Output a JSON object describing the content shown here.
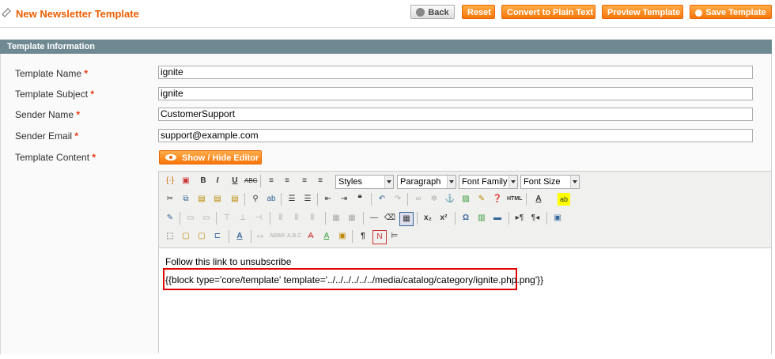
{
  "header": {
    "title": "New Newsletter Template",
    "buttons": {
      "back": "Back",
      "reset": "Reset",
      "convert": "Convert to Plain Text",
      "preview": "Preview Template",
      "save": "Save Template"
    }
  },
  "section": {
    "title": "Template Information"
  },
  "form": {
    "template_name": {
      "label": "Template Name",
      "value": "ignite"
    },
    "template_subject": {
      "label": "Template Subject",
      "value": "ignite"
    },
    "sender_name": {
      "label": "Sender Name",
      "value": "CustomerSupport"
    },
    "sender_email": {
      "label": "Sender Email",
      "value": "support@example.com"
    },
    "template_content": {
      "label": "Template Content"
    },
    "required_mark": "*"
  },
  "editor": {
    "toggle_label": "Show / Hide Editor",
    "dropdowns": {
      "styles": "Styles",
      "paragraph": "Paragraph",
      "font_family": "Font Family",
      "font_size": "Font Size"
    },
    "content": {
      "line1": "Follow this link to unsubscribe",
      "line2": "{{block type='core/template' template='../../../../../../media/catalog/category/ignite.php.png'}}"
    }
  },
  "colors": {
    "accent": "#eb5e00",
    "section": "#6f8992",
    "highlight": "#e00000"
  }
}
